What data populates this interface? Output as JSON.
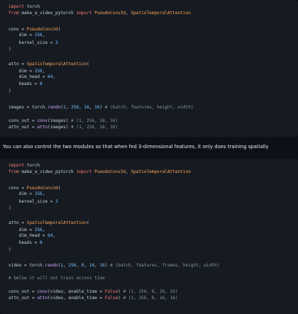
{
  "colors": {
    "background": "#0d1117",
    "code_background": "#161b22",
    "keyword": "#ff7b72",
    "class_name": "#ffa657",
    "number": "#79c0ff",
    "function": "#d2a8ff",
    "comment": "#8b949e",
    "text": "#c9d1d9"
  },
  "code_block_1": {
    "lines": [
      [
        {
          "t": "kw",
          "s": "import"
        },
        {
          "t": "txt",
          "s": " torch"
        }
      ],
      [
        {
          "t": "kw",
          "s": "from"
        },
        {
          "t": "txt",
          "s": " make_a_video_pytorch "
        },
        {
          "t": "kw",
          "s": "import"
        },
        {
          "t": "txt",
          "s": " "
        },
        {
          "t": "cls",
          "s": "PseudoConv3d"
        },
        {
          "t": "txt",
          "s": ", "
        },
        {
          "t": "cls",
          "s": "SpatioTemporalAttention"
        }
      ],
      [],
      [
        {
          "t": "txt",
          "s": "conv = "
        },
        {
          "t": "cls",
          "s": "PseudoConv3d"
        },
        {
          "t": "txt",
          "s": "("
        }
      ],
      [
        {
          "t": "txt",
          "s": "    dim = "
        },
        {
          "t": "num",
          "s": "256"
        },
        {
          "t": "txt",
          "s": ","
        }
      ],
      [
        {
          "t": "txt",
          "s": "    kernel_size = "
        },
        {
          "t": "num",
          "s": "3"
        }
      ],
      [
        {
          "t": "txt",
          "s": ")"
        }
      ],
      [],
      [
        {
          "t": "txt",
          "s": "attn = "
        },
        {
          "t": "cls",
          "s": "SpatioTemporalAttention"
        },
        {
          "t": "txt",
          "s": "("
        }
      ],
      [
        {
          "t": "txt",
          "s": "    dim = "
        },
        {
          "t": "num",
          "s": "256"
        },
        {
          "t": "txt",
          "s": ","
        }
      ],
      [
        {
          "t": "txt",
          "s": "    dim_head = "
        },
        {
          "t": "num",
          "s": "64"
        },
        {
          "t": "txt",
          "s": ","
        }
      ],
      [
        {
          "t": "txt",
          "s": "    heads = "
        },
        {
          "t": "num",
          "s": "8"
        }
      ],
      [
        {
          "t": "txt",
          "s": ")"
        }
      ],
      [],
      [
        {
          "t": "txt",
          "s": "images = torch."
        },
        {
          "t": "fn",
          "s": "randn"
        },
        {
          "t": "txt",
          "s": "("
        },
        {
          "t": "num",
          "s": "1"
        },
        {
          "t": "txt",
          "s": ", "
        },
        {
          "t": "num",
          "s": "256"
        },
        {
          "t": "txt",
          "s": ", "
        },
        {
          "t": "num",
          "s": "16"
        },
        {
          "t": "txt",
          "s": ", "
        },
        {
          "t": "num",
          "s": "16"
        },
        {
          "t": "txt",
          "s": ") "
        },
        {
          "t": "com",
          "s": "# (batch, features, height, width)"
        }
      ],
      [],
      [
        {
          "t": "txt",
          "s": "conv_out = "
        },
        {
          "t": "fn",
          "s": "conv"
        },
        {
          "t": "txt",
          "s": "(images) "
        },
        {
          "t": "com",
          "s": "# (1, 256, 16, 16)"
        }
      ],
      [
        {
          "t": "txt",
          "s": "attn_out = "
        },
        {
          "t": "fn",
          "s": "attn"
        },
        {
          "t": "txt",
          "s": "(images) "
        },
        {
          "t": "com",
          "s": "# (1, 256, 16, 16)"
        }
      ]
    ]
  },
  "prose_text": "You can also control the two modules so that when fed 3-dimensional features, it only does training spatially",
  "code_block_2": {
    "lines": [
      [
        {
          "t": "kw",
          "s": "import"
        },
        {
          "t": "txt",
          "s": " torch"
        }
      ],
      [
        {
          "t": "kw",
          "s": "from"
        },
        {
          "t": "txt",
          "s": " make_a_video_pytorch "
        },
        {
          "t": "kw",
          "s": "import"
        },
        {
          "t": "txt",
          "s": " "
        },
        {
          "t": "cls",
          "s": "PseudoConv3d"
        },
        {
          "t": "txt",
          "s": ", "
        },
        {
          "t": "cls",
          "s": "SpatioTemporalAttention"
        }
      ],
      [],
      [
        {
          "t": "txt",
          "s": "conv = "
        },
        {
          "t": "cls",
          "s": "PseudoConv3d"
        },
        {
          "t": "txt",
          "s": "("
        }
      ],
      [
        {
          "t": "txt",
          "s": "    dim = "
        },
        {
          "t": "num",
          "s": "256"
        },
        {
          "t": "txt",
          "s": ","
        }
      ],
      [
        {
          "t": "txt",
          "s": "    kernel_size = "
        },
        {
          "t": "num",
          "s": "3"
        }
      ],
      [
        {
          "t": "txt",
          "s": ")"
        }
      ],
      [],
      [
        {
          "t": "txt",
          "s": "attn = "
        },
        {
          "t": "cls",
          "s": "SpatioTemporalAttention"
        },
        {
          "t": "txt",
          "s": "("
        }
      ],
      [
        {
          "t": "txt",
          "s": "    dim = "
        },
        {
          "t": "num",
          "s": "256"
        },
        {
          "t": "txt",
          "s": ","
        }
      ],
      [
        {
          "t": "txt",
          "s": "    dim_head = "
        },
        {
          "t": "num",
          "s": "64"
        },
        {
          "t": "txt",
          "s": ","
        }
      ],
      [
        {
          "t": "txt",
          "s": "    heads = "
        },
        {
          "t": "num",
          "s": "8"
        }
      ],
      [
        {
          "t": "txt",
          "s": ")"
        }
      ],
      [],
      [
        {
          "t": "txt",
          "s": "video = torch."
        },
        {
          "t": "fn",
          "s": "randn"
        },
        {
          "t": "txt",
          "s": "("
        },
        {
          "t": "num",
          "s": "1"
        },
        {
          "t": "txt",
          "s": ", "
        },
        {
          "t": "num",
          "s": "256"
        },
        {
          "t": "txt",
          "s": ", "
        },
        {
          "t": "num",
          "s": "8"
        },
        {
          "t": "txt",
          "s": ", "
        },
        {
          "t": "num",
          "s": "16"
        },
        {
          "t": "txt",
          "s": ", "
        },
        {
          "t": "num",
          "s": "16"
        },
        {
          "t": "txt",
          "s": ") "
        },
        {
          "t": "com",
          "s": "# (batch, features, frames, height, width)"
        }
      ],
      [],
      [
        {
          "t": "com",
          "s": "# below it will not train across time"
        }
      ],
      [],
      [
        {
          "t": "txt",
          "s": "conv_out = "
        },
        {
          "t": "fn",
          "s": "conv"
        },
        {
          "t": "txt",
          "s": "(video, enable_time = "
        },
        {
          "t": "kw",
          "s": "False"
        },
        {
          "t": "txt",
          "s": ") "
        },
        {
          "t": "com",
          "s": "# (1, 256, 8, 16, 16)"
        }
      ],
      [
        {
          "t": "txt",
          "s": "attn_out = "
        },
        {
          "t": "fn",
          "s": "attn"
        },
        {
          "t": "txt",
          "s": "(video, enable_time = "
        },
        {
          "t": "kw",
          "s": "False"
        },
        {
          "t": "txt",
          "s": ") "
        },
        {
          "t": "com",
          "s": "# (1, 256, 8, 16, 16)"
        }
      ]
    ]
  }
}
